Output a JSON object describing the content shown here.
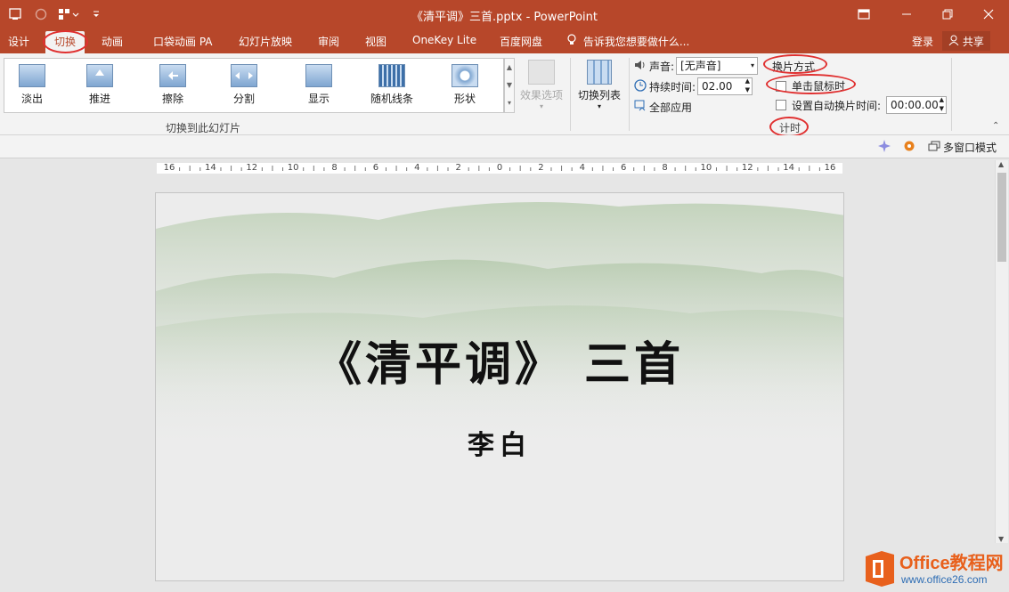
{
  "window": {
    "title": "《清平调》三首.pptx - PowerPoint",
    "controls": [
      "ribbon-display",
      "minimize",
      "restore",
      "close"
    ]
  },
  "tabs": [
    {
      "label": "设计",
      "active": false
    },
    {
      "label": "切换",
      "active": true
    },
    {
      "label": "动画",
      "active": false
    },
    {
      "label": "口袋动画 PA",
      "active": false
    },
    {
      "label": "幻灯片放映",
      "active": false
    },
    {
      "label": "审阅",
      "active": false
    },
    {
      "label": "视图",
      "active": false
    },
    {
      "label": "OneKey Lite",
      "active": false
    },
    {
      "label": "百度网盘",
      "active": false
    }
  ],
  "tell_me": "告诉我您想要做什么...",
  "account": {
    "login": "登录",
    "share": "共享"
  },
  "ribbon": {
    "transitions": [
      "淡出",
      "推进",
      "擦除",
      "分割",
      "显示",
      "随机线条",
      "形状"
    ],
    "transitions_group_label": "切换到此幻灯片",
    "effect_options": "效果选项",
    "transition_list": "切换列表",
    "sound_label": "声音:",
    "sound_value": "[无声音]",
    "duration_label": "持续时间:",
    "duration_value": "02.00",
    "apply_all": "全部应用",
    "advance_slide_label": "换片方式",
    "on_mouse_click": "单击鼠标时",
    "on_mouse_click_checked": false,
    "after_time_label": "设置自动换片时间:",
    "after_time_checked": false,
    "after_time_value": "00:00.00",
    "timing_group_label": "计时"
  },
  "subbar": {
    "multi_window": "多窗口模式"
  },
  "ruler": {
    "labels": [
      "16",
      "14",
      "12",
      "10",
      "8",
      "6",
      "4",
      "2",
      "0",
      "2",
      "4",
      "6",
      "8",
      "10",
      "12",
      "14",
      "16"
    ]
  },
  "slide": {
    "title": "《清平调》 三首",
    "author": "李白"
  },
  "watermark": {
    "brand": "Office教程网",
    "url": "www.office26.com",
    "brand_color": "#e8601c"
  },
  "colors": {
    "accent": "#b7472a",
    "annotation": "#e03030"
  }
}
